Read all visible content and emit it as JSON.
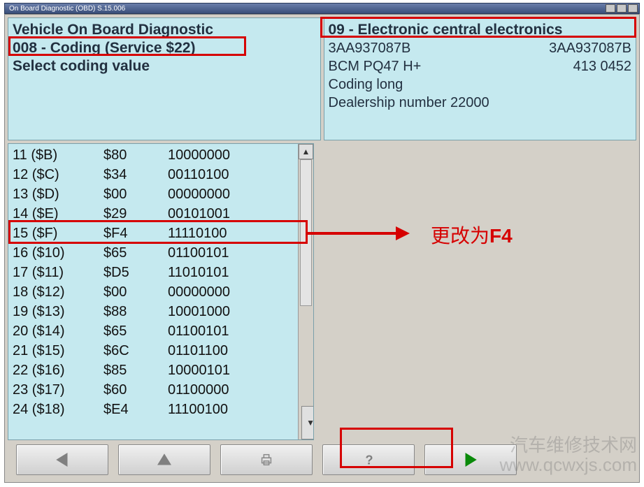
{
  "titlebar": {
    "title": "On Board Diagnostic (OBD) S.15.006"
  },
  "header": {
    "left": {
      "line1": "Vehicle On Board Diagnostic",
      "line2": "008 - Coding (Service $22)",
      "line3": "Select coding value"
    },
    "right": {
      "line1": "09 - Electronic central electronics",
      "pn_left": "3AA937087B",
      "pn_right": "3AA937087B",
      "bcm_left": "BCM PQ47 H+",
      "bcm_right": "413  0452",
      "coding": "Coding long",
      "dealer": "Dealership number 22000"
    }
  },
  "list": {
    "rows": [
      {
        "idx": "11",
        "hex": "($B)",
        "val": "$80",
        "bin": "10000000"
      },
      {
        "idx": "12",
        "hex": "($C)",
        "val": "$34",
        "bin": "00110100"
      },
      {
        "idx": "13",
        "hex": "($D)",
        "val": "$00",
        "bin": "00000000"
      },
      {
        "idx": "14",
        "hex": "($E)",
        "val": "$29",
        "bin": "00101001"
      },
      {
        "idx": "15",
        "hex": "($F)",
        "val": "$F4",
        "bin": "11110100"
      },
      {
        "idx": "16",
        "hex": "($10)",
        "val": "$65",
        "bin": "01100101"
      },
      {
        "idx": "17",
        "hex": "($11)",
        "val": "$D5",
        "bin": "11010101"
      },
      {
        "idx": "18",
        "hex": "($12)",
        "val": "$00",
        "bin": "00000000"
      },
      {
        "idx": "19",
        "hex": "($13)",
        "val": "$88",
        "bin": "10001000"
      },
      {
        "idx": "20",
        "hex": "($14)",
        "val": "$65",
        "bin": "01100101"
      },
      {
        "idx": "21",
        "hex": "($15)",
        "val": "$6C",
        "bin": "01101100"
      },
      {
        "idx": "22",
        "hex": "($16)",
        "val": "$85",
        "bin": "10000101"
      },
      {
        "idx": "23",
        "hex": "($17)",
        "val": "$60",
        "bin": "01100000"
      },
      {
        "idx": "24",
        "hex": "($18)",
        "val": "$E4",
        "bin": "11100100"
      }
    ]
  },
  "annotations": {
    "change_to": "更改为",
    "change_val": "F4"
  },
  "watermark": {
    "line1": "汽车维修技术网",
    "line2": "www.qcwxjs.com"
  }
}
